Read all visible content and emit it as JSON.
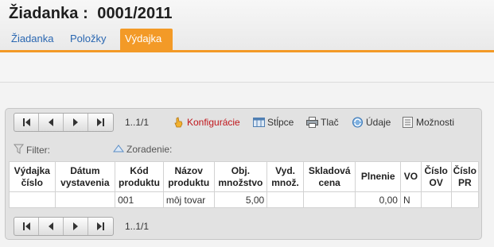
{
  "header": {
    "title": "Žiadanka :  0001/2011",
    "tabs": [
      {
        "label": "Žiadanka",
        "active": false
      },
      {
        "label": "Položky",
        "active": false
      },
      {
        "label": "Výdajka",
        "active": true
      }
    ]
  },
  "colors": {
    "accent": "#f39a27",
    "tab_text": "#2a67b1",
    "config_text": "#c0161b"
  },
  "toolbar": {
    "pager_count": "1..1/1",
    "items": [
      {
        "label": "Konfigurácie",
        "icon": "hand-pointer-icon"
      },
      {
        "label": "Stĺpce",
        "icon": "columns-icon"
      },
      {
        "label": "Tlač",
        "icon": "printer-icon"
      },
      {
        "label": "Údaje",
        "icon": "data-refresh-icon"
      },
      {
        "label": "Možnosti",
        "icon": "options-icon"
      }
    ]
  },
  "filter": {
    "filter_label": "Filter:",
    "sort_label": "Zoradenie:"
  },
  "table": {
    "columns": [
      "Výdajka číslo",
      "Dátum vystavenia",
      "Kód produktu",
      "Názov produktu",
      "Obj. množstvo",
      "Vyd. množ.",
      "Skladová cena",
      "Plnenie",
      "VO",
      "Číslo OV",
      "Číslo PR"
    ],
    "rows": [
      [
        "",
        "",
        "001",
        "môj tovar",
        "5,00",
        "",
        "",
        "0,00",
        "N",
        "",
        ""
      ]
    ]
  },
  "bottom_pager": {
    "count": "1..1/1"
  }
}
